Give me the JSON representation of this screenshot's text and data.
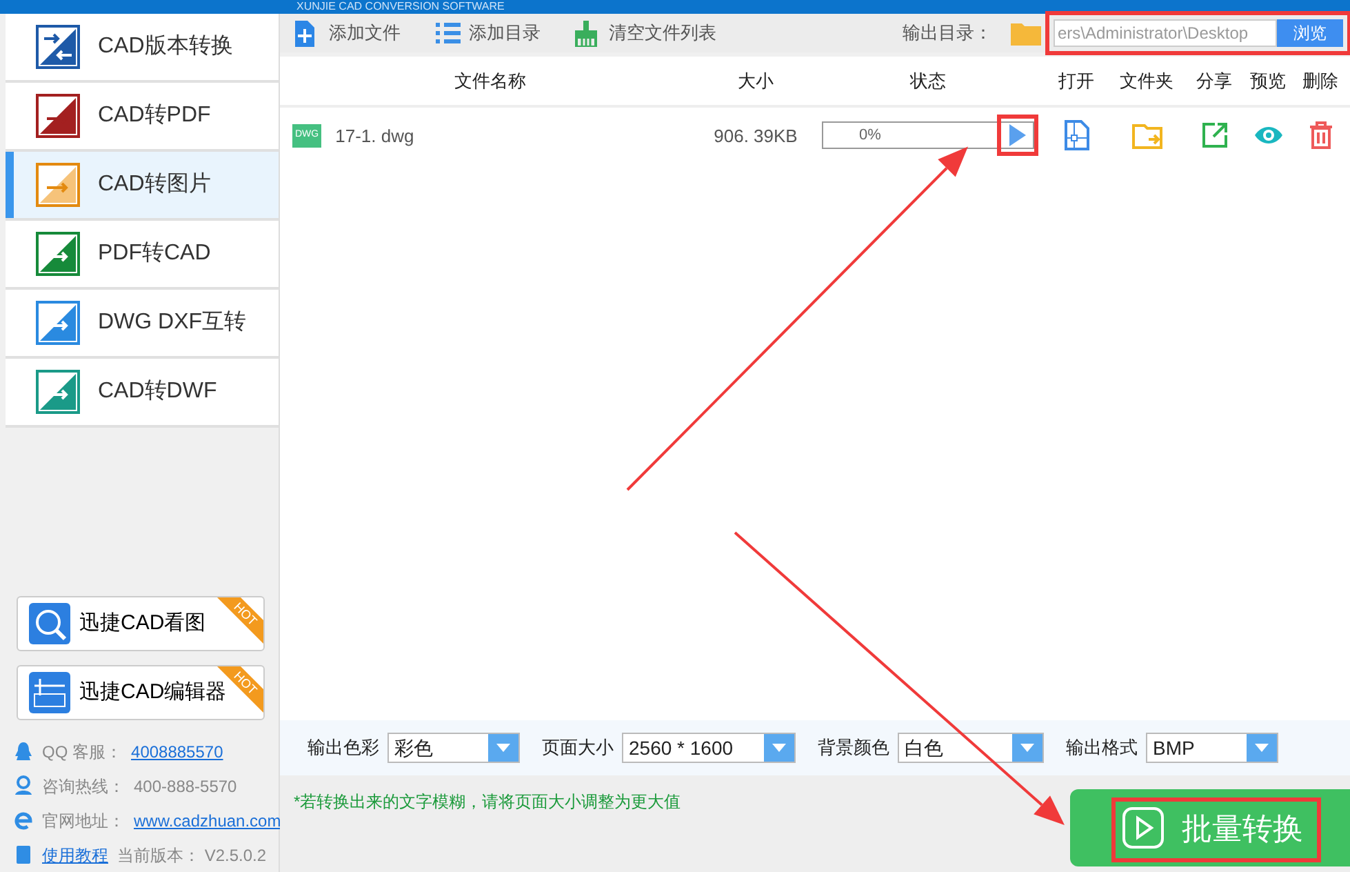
{
  "app_header": {
    "subtitle": "XUNJIE CAD CONVERSION SOFTWARE"
  },
  "sidebar": {
    "items": [
      {
        "label": "CAD版本转换",
        "selected": false
      },
      {
        "label": "CAD转PDF",
        "selected": false
      },
      {
        "label": "CAD转图片",
        "selected": true
      },
      {
        "label": "PDF转CAD",
        "selected": false
      },
      {
        "label": "DWG DXF互转",
        "selected": false
      },
      {
        "label": "CAD转DWF",
        "selected": false
      }
    ],
    "promos": [
      {
        "label": "迅捷CAD看图",
        "badge": "HOT"
      },
      {
        "label": "迅捷CAD编辑器",
        "badge": "HOT"
      }
    ],
    "contacts": [
      {
        "label": "QQ 客服：",
        "value": "4008885570",
        "link": true,
        "label_link": false
      },
      {
        "label": "咨询热线：",
        "value": "400-888-5570",
        "link": false,
        "label_link": false
      },
      {
        "label": "官网地址：",
        "value": "www.cadzhuan.com",
        "link": true,
        "label_link": false
      },
      {
        "label": "使用教程",
        "value": "当前版本： V2.5.0.2",
        "link": false,
        "label_link": true
      }
    ]
  },
  "toolbar": {
    "buttons": [
      {
        "label": "添加文件"
      },
      {
        "label": "添加目录"
      },
      {
        "label": "清空文件列表"
      }
    ],
    "output_dir": {
      "label": "输出目录：",
      "value": "ers\\Administrator\\Desktop",
      "button": "浏览",
      "highlighted": true
    }
  },
  "table": {
    "columns": [
      "文件名称",
      "大小",
      "状态",
      "打开",
      "文件夹",
      "分享",
      "预览",
      "删除"
    ],
    "rows": [
      {
        "type_badge": "DWG",
        "name": "17-1. dwg",
        "size": "906. 39KB",
        "progress": {
          "level": 0,
          "text": "0%"
        },
        "play_highlighted": true
      }
    ]
  },
  "options": [
    {
      "label": "输出色彩",
      "value": "彩色"
    },
    {
      "label": "页面大小",
      "value": "2560 * 1600"
    },
    {
      "label": "背景颜色",
      "value": "白色"
    },
    {
      "label": "输出格式",
      "value": "BMP"
    }
  ],
  "note": "*若转换出来的文字模糊，请将页面大小调整为更大值",
  "convert_button": {
    "label": "批量转换",
    "highlighted": true
  }
}
